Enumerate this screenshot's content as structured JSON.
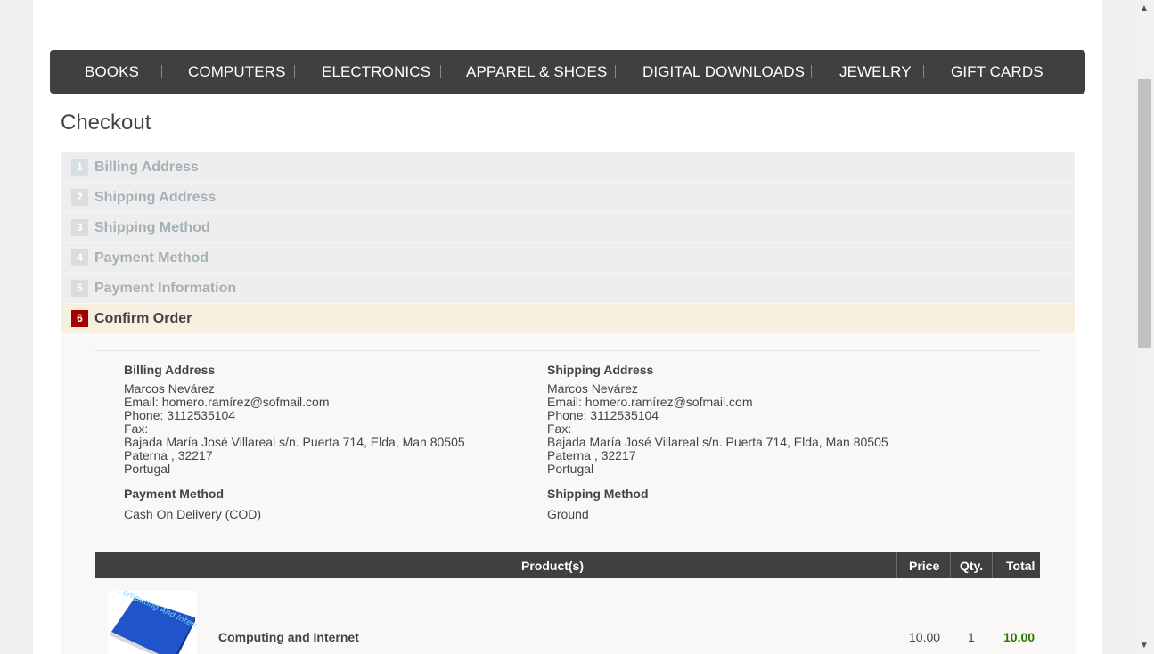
{
  "nav": {
    "items": [
      {
        "label": "BOOKS"
      },
      {
        "label": "COMPUTERS"
      },
      {
        "label": "ELECTRONICS"
      },
      {
        "label": "APPAREL & SHOES"
      },
      {
        "label": "DIGITAL DOWNLOADS"
      },
      {
        "label": "JEWELRY"
      },
      {
        "label": "GIFT CARDS"
      }
    ]
  },
  "page_title": "Checkout",
  "steps": [
    {
      "num": "1",
      "label": "Billing Address"
    },
    {
      "num": "2",
      "label": "Shipping Address"
    },
    {
      "num": "3",
      "label": "Shipping Method"
    },
    {
      "num": "4",
      "label": "Payment Method"
    },
    {
      "num": "5",
      "label": "Payment Information"
    },
    {
      "num": "6",
      "label": "Confirm Order"
    }
  ],
  "billing": {
    "heading": "Billing Address",
    "name": "Marcos Nevárez",
    "email": "Email: homero.ramírez@sofmail.com",
    "phone": "Phone: 3112535104",
    "fax": "Fax:",
    "address": "Bajada María José Villareal s/n. Puerta 714, Elda, Man 80505",
    "city": "Paterna , 32217",
    "country": "Portugal"
  },
  "shipping": {
    "heading": "Shipping Address",
    "name": "Marcos Nevárez",
    "email": "Email: homero.ramírez@sofmail.com",
    "phone": "Phone: 3112535104",
    "fax": "Fax:",
    "address": "Bajada María José Villareal s/n. Puerta 714, Elda, Man 80505",
    "city": "Paterna , 32217",
    "country": "Portugal"
  },
  "payment_method": {
    "heading": "Payment Method",
    "value": "Cash On Delivery (COD)"
  },
  "shipping_method": {
    "heading": "Shipping Method",
    "value": "Ground"
  },
  "cart": {
    "headers": {
      "product": "Product(s)",
      "price": "Price",
      "qty": "Qty.",
      "total": "Total"
    },
    "rows": [
      {
        "name": "Computing and Internet",
        "price": "10.00",
        "qty": "1",
        "total": "10.00",
        "image_text": "Computing And Internet"
      }
    ]
  },
  "colors": {
    "nav_bg": "#404040",
    "active_step": "#a40000",
    "total_green": "#2a7a00"
  }
}
